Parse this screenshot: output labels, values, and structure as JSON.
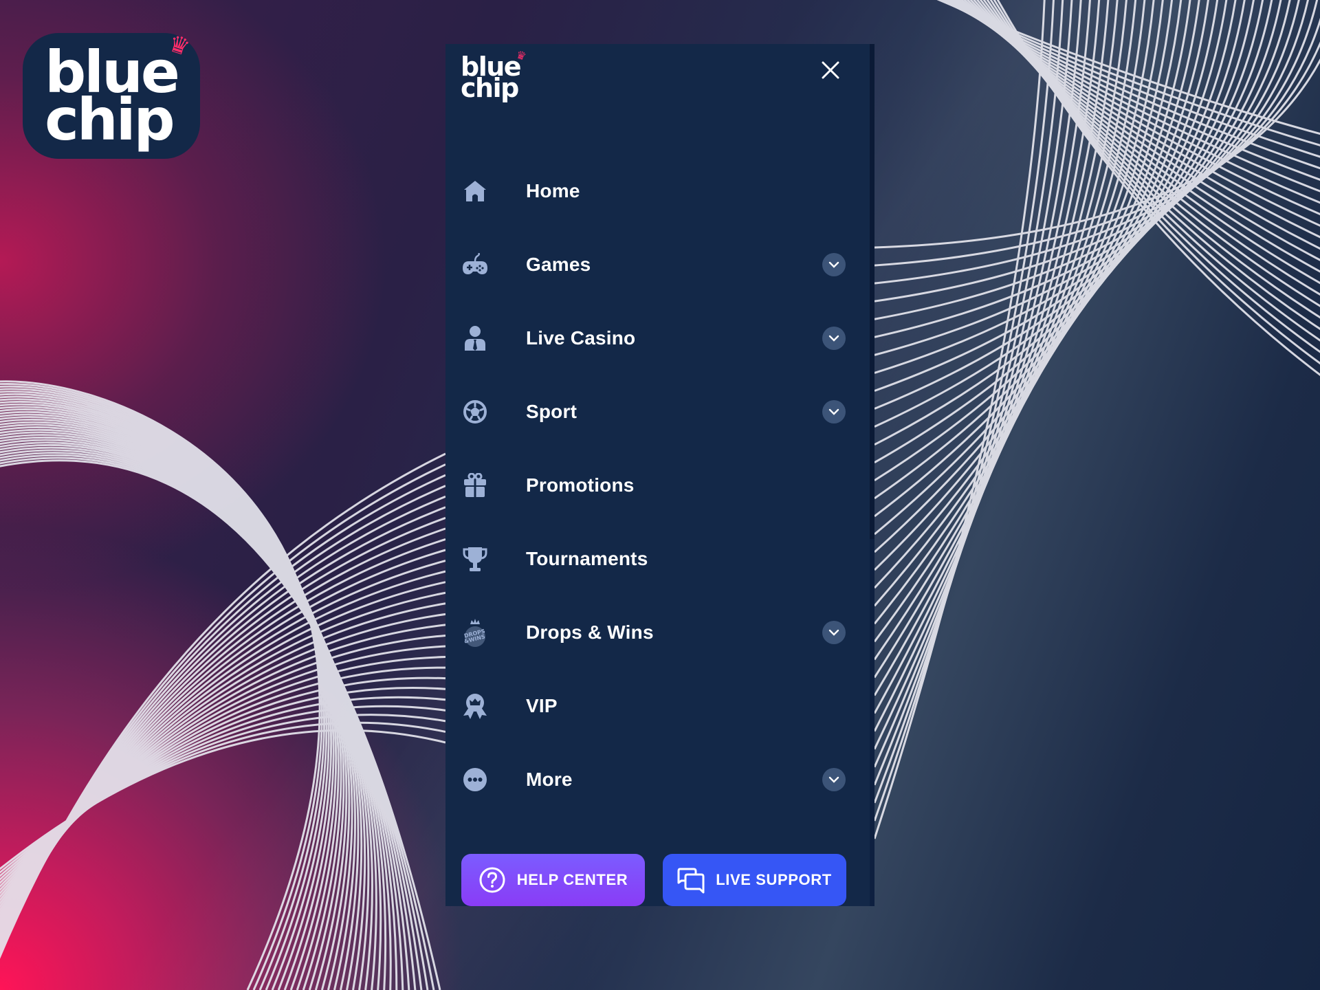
{
  "brand": {
    "name_line1": "blue",
    "name_line2": "chip",
    "crown_glyph": "♛",
    "accent_color": "#ff2d6a",
    "panel_color": "#132848"
  },
  "drawer": {
    "close_icon": "close-icon",
    "nav_items": [
      {
        "label": "Home",
        "icon": "home-icon",
        "expandable": false
      },
      {
        "label": "Games",
        "icon": "gamepad-icon",
        "expandable": true
      },
      {
        "label": "Live Casino",
        "icon": "dealer-icon",
        "expandable": true
      },
      {
        "label": "Sport",
        "icon": "soccer-ball-icon",
        "expandable": true
      },
      {
        "label": "Promotions",
        "icon": "gift-icon",
        "expandable": false
      },
      {
        "label": "Tournaments",
        "icon": "trophy-icon",
        "expandable": false
      },
      {
        "label": "Drops & Wins",
        "icon": "drops-wins-icon",
        "expandable": true
      },
      {
        "label": "VIP",
        "icon": "vip-badge-icon",
        "expandable": false
      },
      {
        "label": "More",
        "icon": "more-dots-icon",
        "expandable": true
      }
    ],
    "drops_wins_badge_text": "DROPS & WINS",
    "help_center_label": "HELP CENTER",
    "live_support_label": "LIVE SUPPORT",
    "help_center_color": "#7b5cff",
    "live_support_color": "#3656f5"
  }
}
